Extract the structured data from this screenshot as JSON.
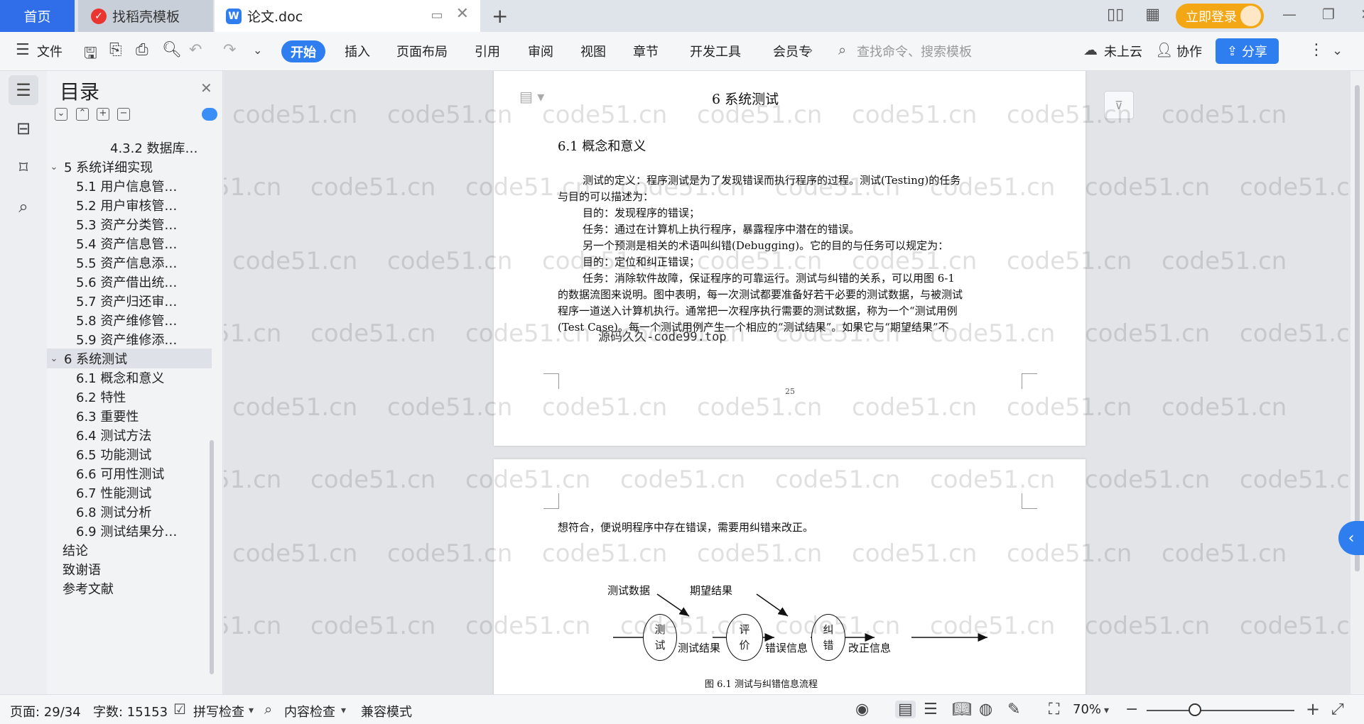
{
  "tabs": {
    "home": "首页",
    "zhaodaoke": "找稻壳模板",
    "doc": "论文.doc"
  },
  "header": {
    "login": "立即登录"
  },
  "toolbar": {
    "file": "文件",
    "start": "开始",
    "insert": "插入",
    "layout": "页面布局",
    "reference": "引用",
    "review": "审阅",
    "view": "视图",
    "chapter": "章节",
    "dev": "开发工具",
    "member": "会员专",
    "search_placeholder": "查找命令、搜索模板",
    "cloud": "未上云",
    "collab": "协作",
    "share": "分享"
  },
  "outline": {
    "title": "目录",
    "items": [
      {
        "label": "4.3.2 数据库…"
      },
      {
        "label": "5 系统详细实现"
      },
      {
        "label": "5.1  用户信息管…"
      },
      {
        "label": "5.2  用户审核管…"
      },
      {
        "label": "5.3  资产分类管…"
      },
      {
        "label": "5.4  资产信息管…"
      },
      {
        "label": "5.5  资产信息添…"
      },
      {
        "label": "5.6  资产借出统…"
      },
      {
        "label": "5.7  资产归还审…"
      },
      {
        "label": "5.8  资产维修管…"
      },
      {
        "label": "5.9  资产维修添…"
      },
      {
        "label": "6 系统测试"
      },
      {
        "label": "6.1 概念和意义"
      },
      {
        "label": "6.2 特性"
      },
      {
        "label": "6.3 重要性"
      },
      {
        "label": "6.4 测试方法"
      },
      {
        "label": "6.5  功能测试"
      },
      {
        "label": "6.6 可用性测试"
      },
      {
        "label": "6.7 性能测试"
      },
      {
        "label": "6.8 测试分析"
      },
      {
        "label": "6.9 测试结果分…"
      },
      {
        "label": "结论"
      },
      {
        "label": "致谢语"
      },
      {
        "label": "参考文献"
      }
    ]
  },
  "document": {
    "chapter_title": "6 系统测试",
    "section_title": "6.1 概念和意义",
    "lines": [
      "测试的定义：程序测试是为了发现错误而执行程序的过程。测试(Testing)的任务",
      "与目的可以描述为：",
      "目的：发现程序的错误；",
      "任务：通过在计算机上执行程序，暴露程序中潜在的错误。",
      "另一个预测是相关的术语叫纠错(Debugging)。它的目的与任务可以规定为：",
      "目的：定位和纠正错误；",
      "任务：消除软件故障，保证程序的可靠运行。测试与纠错的关系，可以用图 6-1",
      "的数据流图来说明。图中表明，每一次测试都要准备好若干必要的测试数据，与被测试",
      "程序一道送入计算机执行。通常把一次程序执行需要的测试数据，称为一个“测试用例",
      "(Test Case)。每一个测试用例产生一个相应的“测试结果”。如果它与“期望结果”不"
    ],
    "page_watermark": "源码久久-code99.top",
    "page_number": "25",
    "page2_line": "想符合，便说明程序中存在错误，需要用纠错来改正。",
    "figure": {
      "input_test_data": "测试数据",
      "input_expected": "期望结果",
      "node_test": "测试",
      "node_eval": "评价",
      "node_debug": "纠错",
      "edge_result": "测试结果",
      "edge_error": "错误信息",
      "edge_fix": "改正信息",
      "caption": "图 6.1 测试与纠错信息流程"
    }
  },
  "watermark_text": "code51.cn",
  "status": {
    "page": "页面: 29/34",
    "words": "字数: 15153",
    "spell": "拼写检查",
    "content_check": "内容检查",
    "compat": "兼容模式",
    "zoom": "70%"
  }
}
